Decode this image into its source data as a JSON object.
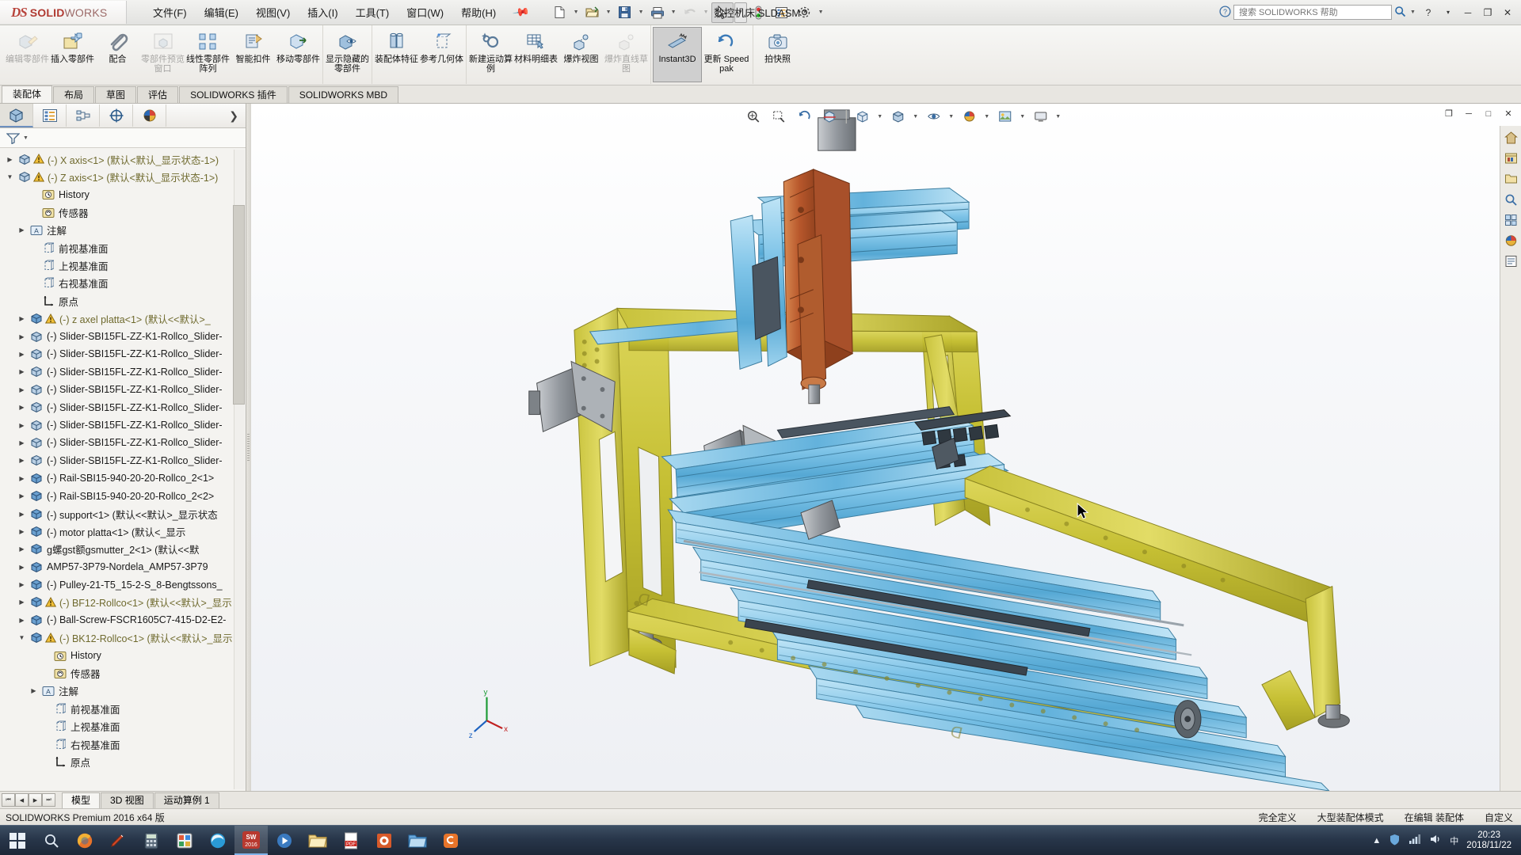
{
  "app": {
    "brand_ds": "DS",
    "brand_name": "SOLID",
    "brand_name_light": "WORKS",
    "document_title": "数控机床.SLDASM *"
  },
  "menu": {
    "items": [
      {
        "label": "文件(F)",
        "name": "menu-file"
      },
      {
        "label": "编辑(E)",
        "name": "menu-edit"
      },
      {
        "label": "视图(V)",
        "name": "menu-view"
      },
      {
        "label": "插入(I)",
        "name": "menu-insert"
      },
      {
        "label": "工具(T)",
        "name": "menu-tools"
      },
      {
        "label": "窗口(W)",
        "name": "menu-window"
      },
      {
        "label": "帮助(H)",
        "name": "menu-help"
      }
    ],
    "pin_icon": "pushpin-icon"
  },
  "quick_access": [
    {
      "name": "new-document-icon",
      "has_caret": true
    },
    {
      "name": "open-document-icon",
      "has_caret": true
    },
    {
      "name": "save-icon",
      "has_caret": true
    },
    {
      "name": "print-icon",
      "has_caret": true
    },
    {
      "name": "undo-icon",
      "has_caret": true,
      "disabled": true
    },
    {
      "name": "select-icon",
      "has_caret": true,
      "selected": true
    },
    {
      "name": "rebuild-icon",
      "has_caret": false
    },
    {
      "name": "file-properties-icon",
      "has_caret": false
    },
    {
      "name": "options-gear-icon",
      "has_caret": true
    }
  ],
  "search": {
    "placeholder": "搜索 SOLIDWORKS 帮助",
    "value": "",
    "icon": "search-icon",
    "help_icon": "help-circle-icon",
    "dropdown_icon": "chevron-down-icon"
  },
  "window_controls": {
    "help": "?",
    "help_caret": "▾",
    "minimize": "─",
    "restore": "❐",
    "close": "✕"
  },
  "ribbon": {
    "groups": [
      {
        "buttons": [
          {
            "label": "编辑零部件",
            "icon": "edit-component-icon",
            "disabled": true,
            "name": "ribbon-edit-component"
          },
          {
            "label": "插入零部件",
            "icon": "insert-component-icon",
            "disabled": false,
            "name": "ribbon-insert-component"
          },
          {
            "label": "配合",
            "icon": "mate-paperclip-icon",
            "disabled": false,
            "name": "ribbon-mate"
          },
          {
            "label": "零部件预览窗口",
            "icon": "component-preview-icon",
            "disabled": true,
            "name": "ribbon-component-preview"
          },
          {
            "label": "线性零部件阵列",
            "icon": "linear-pattern-icon",
            "disabled": false,
            "name": "ribbon-linear-pattern"
          },
          {
            "label": "智能扣件",
            "icon": "smart-fasteners-icon",
            "disabled": false,
            "name": "ribbon-smart-fasteners"
          },
          {
            "label": "移动零部件",
            "icon": "move-component-icon",
            "disabled": false,
            "name": "ribbon-move-component"
          }
        ]
      },
      {
        "buttons": [
          {
            "label": "显示隐藏的零部件",
            "icon": "show-hidden-components-icon",
            "disabled": false,
            "name": "ribbon-show-hidden"
          }
        ]
      },
      {
        "buttons": [
          {
            "label": "装配体特征",
            "icon": "assembly-features-icon",
            "disabled": false,
            "name": "ribbon-assembly-features"
          },
          {
            "label": "参考几何体",
            "icon": "reference-geometry-icon",
            "disabled": false,
            "name": "ribbon-reference-geometry"
          }
        ]
      },
      {
        "buttons": [
          {
            "label": "新建运动算例",
            "icon": "new-motion-study-icon",
            "disabled": false,
            "name": "ribbon-new-motion-study"
          },
          {
            "label": "材料明细表",
            "icon": "bill-of-materials-icon",
            "disabled": false,
            "name": "ribbon-bom"
          },
          {
            "label": "爆炸视图",
            "icon": "exploded-view-icon",
            "disabled": false,
            "name": "ribbon-exploded-view"
          },
          {
            "label": "爆炸直线草图",
            "icon": "explode-line-sketch-icon",
            "disabled": true,
            "name": "ribbon-explode-line-sketch"
          }
        ]
      },
      {
        "buttons": [
          {
            "label": "Instant3D",
            "icon": "instant3d-icon",
            "disabled": false,
            "selected": true,
            "name": "ribbon-instant3d"
          },
          {
            "label": "更新 Speedpak",
            "icon": "update-speedpak-icon",
            "disabled": false,
            "name": "ribbon-update-speedpak"
          }
        ]
      },
      {
        "buttons": [
          {
            "label": "拍快照",
            "icon": "take-snapshot-icon",
            "disabled": false,
            "name": "ribbon-take-snapshot"
          }
        ]
      }
    ]
  },
  "command_tabs": {
    "items": [
      {
        "label": "装配体",
        "active": true,
        "name": "tab-assembly"
      },
      {
        "label": "布局",
        "active": false,
        "name": "tab-layout"
      },
      {
        "label": "草图",
        "active": false,
        "name": "tab-sketch"
      },
      {
        "label": "评估",
        "active": false,
        "name": "tab-evaluate"
      },
      {
        "label": "SOLIDWORKS 插件",
        "active": false,
        "name": "tab-solidworks-addins"
      },
      {
        "label": "SOLIDWORKS MBD",
        "active": false,
        "name": "tab-solidworks-mbd"
      }
    ]
  },
  "feature_manager": {
    "tabs": [
      {
        "name": "tab-feature-manager-tree",
        "icon": "feature-tree-icon",
        "active": true
      },
      {
        "name": "tab-property-manager",
        "icon": "property-manager-icon",
        "active": false
      },
      {
        "name": "tab-configuration-manager",
        "icon": "configuration-manager-icon",
        "active": false
      },
      {
        "name": "tab-dimxpert-manager",
        "icon": "dimxpert-icon",
        "active": false
      },
      {
        "name": "tab-display-manager",
        "icon": "display-manager-icon",
        "active": false
      }
    ],
    "expand_icon": "chevron-right-icon",
    "filter_icon": "filter-icon",
    "tree": [
      {
        "label": "(-) X axis<1>  (默认<默认_显示状态-1>)",
        "indent": 0,
        "toggle": "right",
        "icon": "part-icon",
        "warn": true,
        "olive": true
      },
      {
        "label": "(-) Z axis<1>  (默认<默认_显示状态-1>)",
        "indent": 0,
        "toggle": "down",
        "icon": "part-icon",
        "warn": true,
        "olive": true
      },
      {
        "label": "History",
        "indent": 2,
        "toggle": "none",
        "icon": "history-icon",
        "warn": false,
        "olive": false
      },
      {
        "label": "传感器",
        "indent": 2,
        "toggle": "none",
        "icon": "sensor-icon",
        "warn": false,
        "olive": false
      },
      {
        "label": "注解",
        "indent": 1,
        "toggle": "right",
        "icon": "annotations-icon",
        "warn": false,
        "olive": false
      },
      {
        "label": "前视基准面",
        "indent": 2,
        "toggle": "none",
        "icon": "plane-icon",
        "warn": false,
        "olive": false
      },
      {
        "label": "上视基准面",
        "indent": 2,
        "toggle": "none",
        "icon": "plane-icon",
        "warn": false,
        "olive": false
      },
      {
        "label": "右视基准面",
        "indent": 2,
        "toggle": "none",
        "icon": "plane-icon",
        "warn": false,
        "olive": false
      },
      {
        "label": "原点",
        "indent": 2,
        "toggle": "none",
        "icon": "origin-icon",
        "warn": false,
        "olive": false
      },
      {
        "label": "(-) z axel platta<1>  (默认<<默认>_",
        "indent": 1,
        "toggle": "right",
        "icon": "part-blue-icon",
        "warn": true,
        "olive": true
      },
      {
        "label": "(-) Slider-SBI15FL-ZZ-K1-Rollco_Slider-",
        "indent": 1,
        "toggle": "right",
        "icon": "part-icon",
        "warn": false,
        "olive": false
      },
      {
        "label": "(-) Slider-SBI15FL-ZZ-K1-Rollco_Slider-",
        "indent": 1,
        "toggle": "right",
        "icon": "part-icon",
        "warn": false,
        "olive": false
      },
      {
        "label": "(-) Slider-SBI15FL-ZZ-K1-Rollco_Slider-",
        "indent": 1,
        "toggle": "right",
        "icon": "part-icon",
        "warn": false,
        "olive": false
      },
      {
        "label": "(-) Slider-SBI15FL-ZZ-K1-Rollco_Slider-",
        "indent": 1,
        "toggle": "right",
        "icon": "part-icon",
        "warn": false,
        "olive": false
      },
      {
        "label": "(-) Slider-SBI15FL-ZZ-K1-Rollco_Slider-",
        "indent": 1,
        "toggle": "right",
        "icon": "part-icon",
        "warn": false,
        "olive": false
      },
      {
        "label": "(-) Slider-SBI15FL-ZZ-K1-Rollco_Slider-",
        "indent": 1,
        "toggle": "right",
        "icon": "part-icon",
        "warn": false,
        "olive": false
      },
      {
        "label": "(-) Slider-SBI15FL-ZZ-K1-Rollco_Slider-",
        "indent": 1,
        "toggle": "right",
        "icon": "part-icon",
        "warn": false,
        "olive": false
      },
      {
        "label": "(-) Slider-SBI15FL-ZZ-K1-Rollco_Slider-",
        "indent": 1,
        "toggle": "right",
        "icon": "part-icon",
        "warn": false,
        "olive": false
      },
      {
        "label": "(-) Rail-SBI15-940-20-20-Rollco_2<1>",
        "indent": 1,
        "toggle": "right",
        "icon": "part-blue-icon",
        "warn": false,
        "olive": false
      },
      {
        "label": "(-) Rail-SBI15-940-20-20-Rollco_2<2>",
        "indent": 1,
        "toggle": "right",
        "icon": "part-blue-icon",
        "warn": false,
        "olive": false
      },
      {
        "label": "(-) support<1>  (默认<<默认>_显示状态",
        "indent": 1,
        "toggle": "right",
        "icon": "part-blue-icon",
        "warn": false,
        "olive": false
      },
      {
        "label": "(-) motor platta<1>  (默认<_显示",
        "indent": 1,
        "toggle": "right",
        "icon": "part-blue-icon",
        "warn": false,
        "olive": false
      },
      {
        "label": "g螺gst额gsmutter_2<1>  (默认<<默",
        "indent": 1,
        "toggle": "right",
        "icon": "part-blue-icon",
        "warn": false,
        "olive": false
      },
      {
        "label": "AMP57-3P79-Nordela_AMP57-3P79",
        "indent": 1,
        "toggle": "right",
        "icon": "part-blue-icon",
        "warn": false,
        "olive": false
      },
      {
        "label": "(-) Pulley-21-T5_15-2-S_8-Bengtssons_",
        "indent": 1,
        "toggle": "right",
        "icon": "part-blue-icon",
        "warn": false,
        "olive": false
      },
      {
        "label": "(-) BF12-Rollco<1>  (默认<<默认>_显示",
        "indent": 1,
        "toggle": "right",
        "icon": "part-blue-icon",
        "warn": true,
        "olive": true
      },
      {
        "label": "(-) Ball-Screw-FSCR1605C7-415-D2-E2-",
        "indent": 1,
        "toggle": "right",
        "icon": "part-blue-icon",
        "warn": false,
        "olive": false
      },
      {
        "label": "(-) BK12-Rollco<1>  (默认<<默认>_显示",
        "indent": 1,
        "toggle": "down",
        "icon": "part-blue-icon",
        "warn": true,
        "olive": true
      },
      {
        "label": "History",
        "indent": 3,
        "toggle": "none",
        "icon": "history-icon",
        "warn": false,
        "olive": false
      },
      {
        "label": "传感器",
        "indent": 3,
        "toggle": "none",
        "icon": "sensor-icon",
        "warn": false,
        "olive": false
      },
      {
        "label": "注解",
        "indent": 2,
        "toggle": "right",
        "icon": "annotations-icon",
        "warn": false,
        "olive": false
      },
      {
        "label": "前视基准面",
        "indent": 3,
        "toggle": "none",
        "icon": "plane-icon",
        "warn": false,
        "olive": false
      },
      {
        "label": "上视基准面",
        "indent": 3,
        "toggle": "none",
        "icon": "plane-icon",
        "warn": false,
        "olive": false
      },
      {
        "label": "右视基准面",
        "indent": 3,
        "toggle": "none",
        "icon": "plane-icon",
        "warn": false,
        "olive": false
      },
      {
        "label": "原点",
        "indent": 3,
        "toggle": "none",
        "icon": "origin-icon",
        "warn": false,
        "olive": false
      }
    ]
  },
  "view_toolbar": [
    {
      "name": "zoom-to-fit-icon",
      "caret": false
    },
    {
      "name": "zoom-to-area-icon",
      "caret": false
    },
    {
      "name": "previous-view-icon",
      "caret": false
    },
    {
      "name": "section-view-icon",
      "caret": false
    },
    {
      "name": "view-orientation-icon",
      "caret": true
    },
    {
      "name": "display-style-icon",
      "caret": true
    },
    {
      "name": "hide-show-items-icon",
      "caret": true
    },
    {
      "name": "edit-appearance-icon",
      "caret": true
    },
    {
      "name": "apply-scene-icon",
      "caret": true
    },
    {
      "name": "view-settings-icon",
      "caret": true
    }
  ],
  "graphics_right_rail": [
    {
      "name": "view-palette-home-icon"
    },
    {
      "name": "design-library-icon"
    },
    {
      "name": "file-explorer-icon"
    },
    {
      "name": "search-library-icon"
    },
    {
      "name": "view-palette-icon"
    },
    {
      "name": "appearances-scenes-icon"
    },
    {
      "name": "custom-properties-icon"
    }
  ],
  "graphics_window_controls": {
    "restore": "❐",
    "minimize": "─",
    "maximize": "□",
    "close": "✕"
  },
  "triad": {
    "x": "x",
    "y": "y",
    "z": "z"
  },
  "bottom_tabs": {
    "items": [
      {
        "label": "模型",
        "active": true,
        "name": "bottom-tab-model"
      },
      {
        "label": "3D 视图",
        "active": false,
        "name": "bottom-tab-3d-views"
      },
      {
        "label": "运动算例 1",
        "active": false,
        "name": "bottom-tab-motion-study-1"
      }
    ]
  },
  "status_bar": {
    "left": "SOLIDWORKS Premium 2016 x64 版",
    "items": [
      "完全定义",
      "大型装配体模式",
      "在编辑 装配体",
      "自定义"
    ]
  },
  "taskbar": {
    "start_name": "start-button-icon",
    "icons": [
      {
        "name": "taskbar-search-icon"
      },
      {
        "name": "taskbar-firefox-icon"
      },
      {
        "name": "taskbar-pen-icon"
      },
      {
        "name": "taskbar-calculator-icon"
      },
      {
        "name": "taskbar-paint-icon"
      },
      {
        "name": "taskbar-edge-icon"
      },
      {
        "name": "taskbar-solidworks-icon",
        "active": true
      },
      {
        "name": "taskbar-media-icon"
      },
      {
        "name": "taskbar-explorer-icon"
      },
      {
        "name": "taskbar-pdf-icon"
      },
      {
        "name": "taskbar-office-icon"
      },
      {
        "name": "taskbar-folder-icon"
      },
      {
        "name": "taskbar-sogou-icon"
      }
    ],
    "tray": [
      {
        "name": "tray-up-arrow-icon"
      },
      {
        "name": "tray-shield-icon"
      },
      {
        "name": "tray-network-icon"
      },
      {
        "name": "tray-volume-icon"
      },
      {
        "name": "tray-ime-icon"
      }
    ],
    "clock_time": "20:23",
    "clock_date": "2018/11/22"
  },
  "colors": {
    "accent": "#b03a32",
    "frame_yellow": "#c9c23a",
    "rail_blue": "#7fc4e8",
    "spindle_orange": "#c2663a",
    "olive_text": "#6f6a2e"
  }
}
